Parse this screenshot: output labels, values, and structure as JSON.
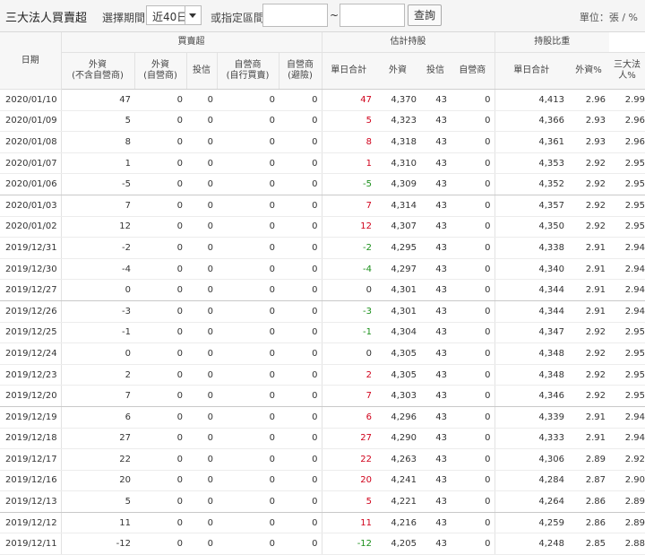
{
  "toolbar": {
    "title": "三大法人買賣超",
    "period_label": "選擇期間",
    "period_value": "近40日",
    "range_label": "或指定區間",
    "tilde": "~",
    "query_label": "查詢",
    "unit": "單位：張 / %"
  },
  "headers": {
    "date": "日期",
    "group_buysell": "買賣超",
    "group_holding": "估計持股",
    "group_ratio": "持股比重",
    "foreign_ex": "外資\n(不含自營商)",
    "foreign_dealer": "外資\n(自營商)",
    "trust": "投信",
    "dealer_self": "自營商\n(自行買賣)",
    "dealer_hedge": "自營商\n(避險)",
    "daily_total": "單日合計",
    "h_foreign": "外資",
    "h_trust": "投信",
    "h_dealer": "自營商",
    "h_daily_total": "單日合計",
    "r_foreign": "外資%",
    "r_three": "三大法人%"
  },
  "rows": [
    [
      "2020/01/10",
      "47",
      "0",
      "0",
      "0",
      "0",
      "47",
      "4,370",
      "43",
      "0",
      "4,413",
      "2.96",
      "2.99"
    ],
    [
      "2020/01/09",
      "5",
      "0",
      "0",
      "0",
      "0",
      "5",
      "4,323",
      "43",
      "0",
      "4,366",
      "2.93",
      "2.96"
    ],
    [
      "2020/01/08",
      "8",
      "0",
      "0",
      "0",
      "0",
      "8",
      "4,318",
      "43",
      "0",
      "4,361",
      "2.93",
      "2.96"
    ],
    [
      "2020/01/07",
      "1",
      "0",
      "0",
      "0",
      "0",
      "1",
      "4,310",
      "43",
      "0",
      "4,353",
      "2.92",
      "2.95"
    ],
    [
      "2020/01/06",
      "-5",
      "0",
      "0",
      "0",
      "0",
      "-5",
      "4,309",
      "43",
      "0",
      "4,352",
      "2.92",
      "2.95"
    ],
    [
      "2020/01/03",
      "7",
      "0",
      "0",
      "0",
      "0",
      "7",
      "4,314",
      "43",
      "0",
      "4,357",
      "2.92",
      "2.95"
    ],
    [
      "2020/01/02",
      "12",
      "0",
      "0",
      "0",
      "0",
      "12",
      "4,307",
      "43",
      "0",
      "4,350",
      "2.92",
      "2.95"
    ],
    [
      "2019/12/31",
      "-2",
      "0",
      "0",
      "0",
      "0",
      "-2",
      "4,295",
      "43",
      "0",
      "4,338",
      "2.91",
      "2.94"
    ],
    [
      "2019/12/30",
      "-4",
      "0",
      "0",
      "0",
      "0",
      "-4",
      "4,297",
      "43",
      "0",
      "4,340",
      "2.91",
      "2.94"
    ],
    [
      "2019/12/27",
      "0",
      "0",
      "0",
      "0",
      "0",
      "0",
      "4,301",
      "43",
      "0",
      "4,344",
      "2.91",
      "2.94"
    ],
    [
      "2019/12/26",
      "-3",
      "0",
      "0",
      "0",
      "0",
      "-3",
      "4,301",
      "43",
      "0",
      "4,344",
      "2.91",
      "2.94"
    ],
    [
      "2019/12/25",
      "-1",
      "0",
      "0",
      "0",
      "0",
      "-1",
      "4,304",
      "43",
      "0",
      "4,347",
      "2.92",
      "2.95"
    ],
    [
      "2019/12/24",
      "0",
      "0",
      "0",
      "0",
      "0",
      "0",
      "4,305",
      "43",
      "0",
      "4,348",
      "2.92",
      "2.95"
    ],
    [
      "2019/12/23",
      "2",
      "0",
      "0",
      "0",
      "0",
      "2",
      "4,305",
      "43",
      "0",
      "4,348",
      "2.92",
      "2.95"
    ],
    [
      "2019/12/20",
      "7",
      "0",
      "0",
      "0",
      "0",
      "7",
      "4,303",
      "43",
      "0",
      "4,346",
      "2.92",
      "2.95"
    ],
    [
      "2019/12/19",
      "6",
      "0",
      "0",
      "0",
      "0",
      "6",
      "4,296",
      "43",
      "0",
      "4,339",
      "2.91",
      "2.94"
    ],
    [
      "2019/12/18",
      "27",
      "0",
      "0",
      "0",
      "0",
      "27",
      "4,290",
      "43",
      "0",
      "4,333",
      "2.91",
      "2.94"
    ],
    [
      "2019/12/17",
      "22",
      "0",
      "0",
      "0",
      "0",
      "22",
      "4,263",
      "43",
      "0",
      "4,306",
      "2.89",
      "2.92"
    ],
    [
      "2019/12/16",
      "20",
      "0",
      "0",
      "0",
      "0",
      "20",
      "4,241",
      "43",
      "0",
      "4,284",
      "2.87",
      "2.90"
    ],
    [
      "2019/12/13",
      "5",
      "0",
      "0",
      "0",
      "0",
      "5",
      "4,221",
      "43",
      "0",
      "4,264",
      "2.86",
      "2.89"
    ],
    [
      "2019/12/12",
      "11",
      "0",
      "0",
      "0",
      "0",
      "11",
      "4,216",
      "43",
      "0",
      "4,259",
      "2.86",
      "2.89"
    ],
    [
      "2019/12/11",
      "-12",
      "0",
      "0",
      "0",
      "0",
      "-12",
      "4,205",
      "43",
      "0",
      "4,248",
      "2.85",
      "2.88"
    ]
  ],
  "colors": {
    "positive": "#d0021b",
    "negative": "#1a8f1a"
  }
}
